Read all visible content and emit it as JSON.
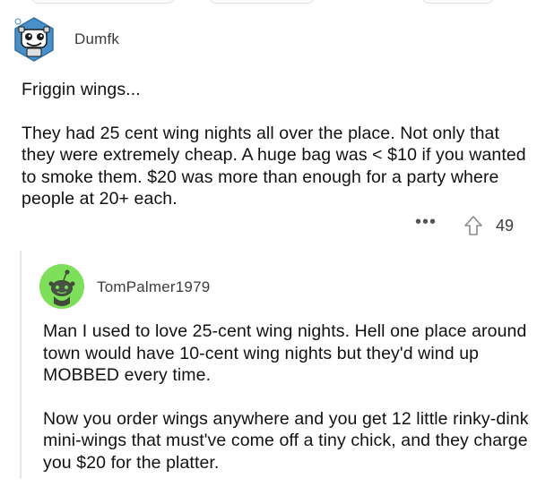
{
  "parent_comment": {
    "username": "Dumfk",
    "paragraphs": [
      "Friggin wings...",
      "They had 25 cent wing nights all over the place. Not only that they were extremely cheap. A huge bag was < $10 if you wanted to smoke them. $20 was more than enough for a party where people at 20+ each."
    ],
    "vote_count": "49",
    "more_label": "•••",
    "avatar_icon": "robot-avatar-icon"
  },
  "reply_comment": {
    "username": "TomPalmer1979",
    "paragraphs": [
      "Man I used to love 25-cent wing nights.  Hell one place around town would have 10-cent wing nights but they'd wind up MOBBED every time.",
      "Now you order wings anywhere and you get 12 little rinky-dink mini-wings that must've come off a tiny chick, and they charge you $20 for the platter."
    ],
    "avatar_icon": "snoo-avatar-icon",
    "avatar_bg": "#7ee05a"
  },
  "colors": {
    "avatar_robot_bg": "#4a90c8",
    "upvote_outline": "#8a8a8a"
  }
}
